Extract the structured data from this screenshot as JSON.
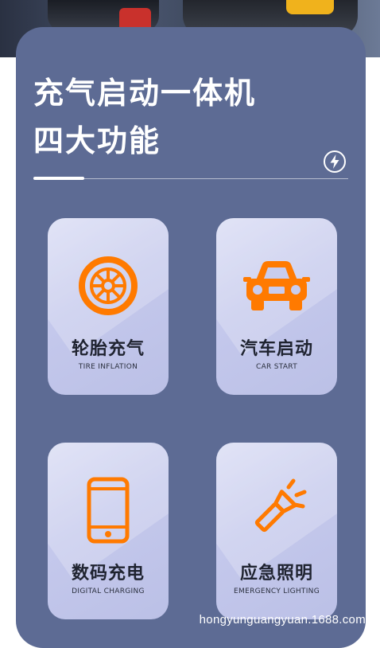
{
  "header": {
    "title_line1": "充气启动一体机",
    "title_line2": "四大功能"
  },
  "features": [
    {
      "cn": "轮胎充气",
      "en": "TIRE INFLATION",
      "icon": "tire-icon"
    },
    {
      "cn": "汽车启动",
      "en": "CAR START",
      "icon": "car-icon"
    },
    {
      "cn": "数码充电",
      "en": "DIGITAL CHARGING",
      "icon": "phone-icon"
    },
    {
      "cn": "应急照明",
      "en": "EMERGENCY LIGHTING",
      "icon": "flashlight-icon"
    }
  ],
  "watermark": "hongyunguangyuan.1688.com",
  "colors": {
    "panel": "#5d6b94",
    "card": "#c8ccee",
    "accent": "#ff7a00"
  }
}
